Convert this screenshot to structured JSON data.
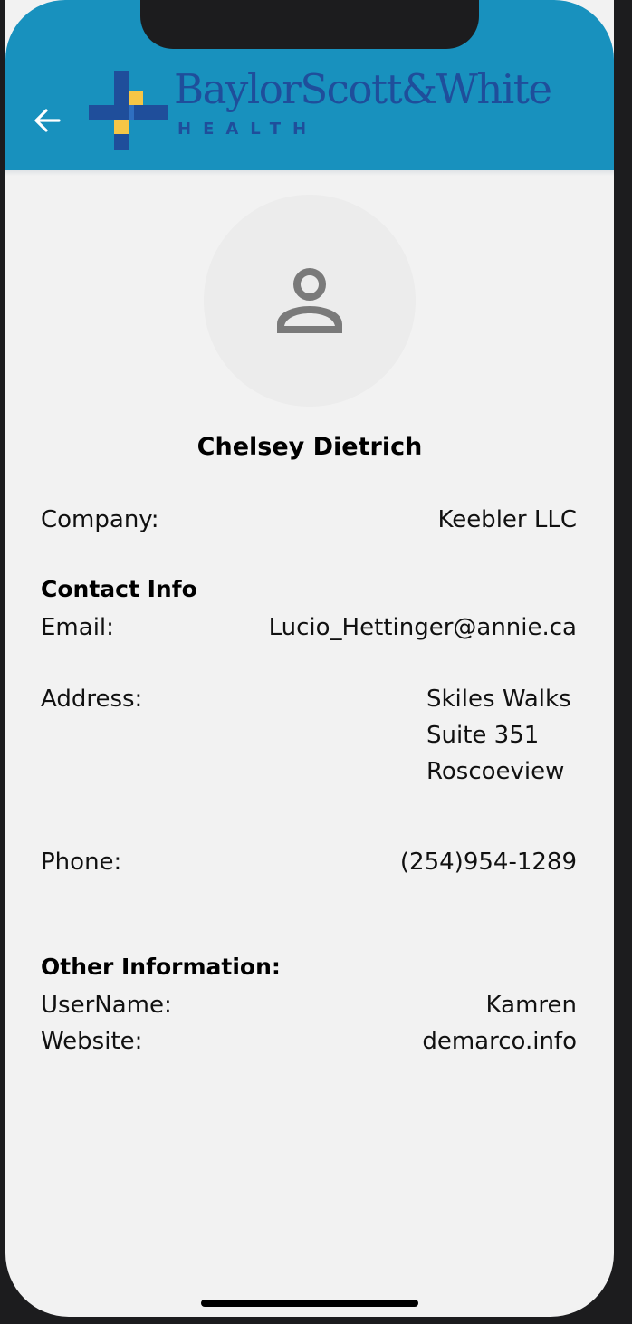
{
  "header": {
    "back_icon": "arrow-left-icon",
    "logo": {
      "wordmark": "BaylorScott&White",
      "subtitle": "HEALTH"
    },
    "colors": {
      "header_bg": "#1891be",
      "logo_blue": "#1f4e9b",
      "logo_yellow": "#f6c646"
    }
  },
  "profile": {
    "avatar_icon": "person-icon",
    "name": "Chelsey Dietrich"
  },
  "company": {
    "label": "Company:",
    "value": "Keebler LLC"
  },
  "contact": {
    "title": "Contact Info",
    "email_label": "Email:",
    "email_value": "Lucio_Hettinger@annie.ca",
    "address_label": "Address:",
    "address_lines": [
      "Skiles Walks",
      "Suite 351",
      "Roscoeview"
    ],
    "phone_label": "Phone:",
    "phone_value": "(254)954-1289"
  },
  "other": {
    "title": "Other Information:",
    "username_label": "UserName:",
    "username_value": "Kamren",
    "website_label": "Website:",
    "website_value": "demarco.info"
  }
}
